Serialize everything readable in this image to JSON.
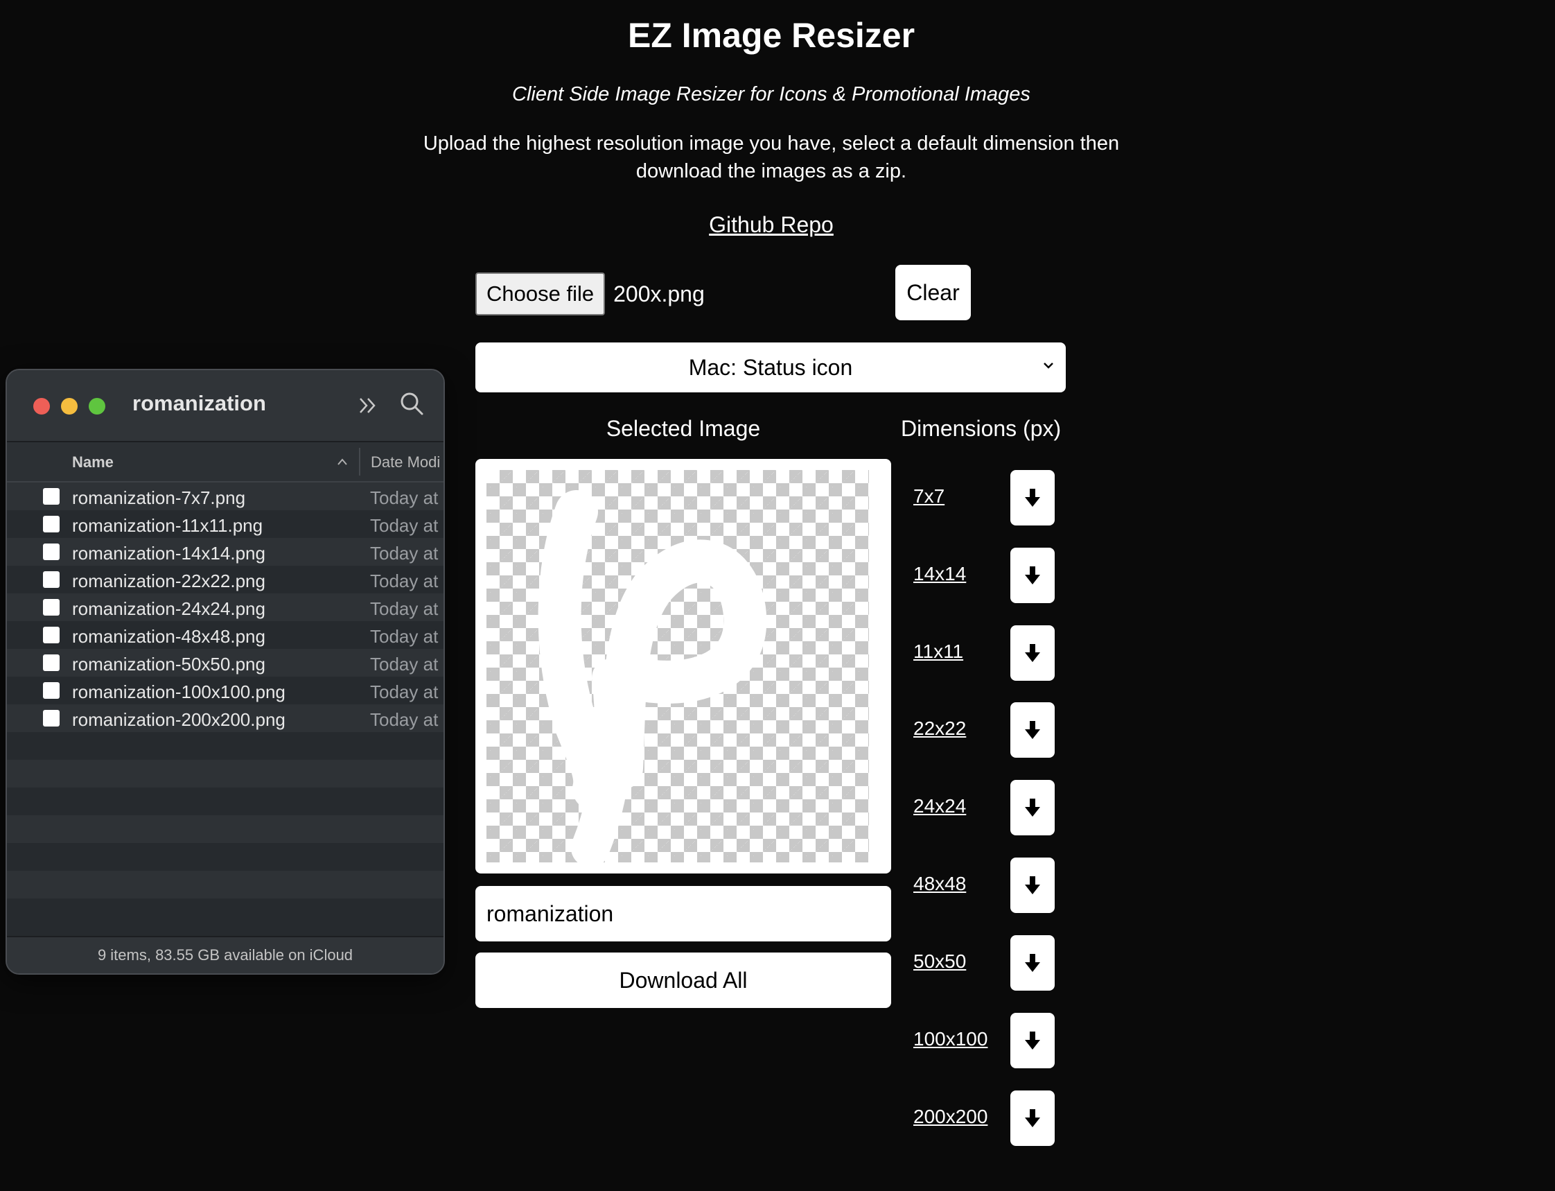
{
  "app": {
    "title": "EZ Image Resizer",
    "subtitle": "Client Side Image Resizer for Icons & Promotional Images",
    "instructions": "Upload the highest resolution image you have, select a default dimension then download the images as a zip.",
    "repo_link": "Github Repo"
  },
  "file_input": {
    "button_label": "Choose file",
    "selected_file": "200x.png"
  },
  "clear_label": "Clear",
  "preset": {
    "selected": "Mac: Status icon"
  },
  "preview": {
    "header": "Selected Image"
  },
  "dimensions": {
    "header": "Dimensions (px)",
    "items": [
      "7x7",
      "14x14",
      "11x11",
      "22x22",
      "24x24",
      "48x48",
      "50x50",
      "100x100",
      "200x200"
    ]
  },
  "name_input": {
    "value": "romanization"
  },
  "download_all_label": "Download All",
  "finder": {
    "title": "romanization",
    "columns": {
      "name": "Name",
      "date": "Date Modi"
    },
    "files": [
      {
        "name": "romanization-7x7.png",
        "date": "Today at"
      },
      {
        "name": "romanization-11x11.png",
        "date": "Today at"
      },
      {
        "name": "romanization-14x14.png",
        "date": "Today at"
      },
      {
        "name": "romanization-22x22.png",
        "date": "Today at"
      },
      {
        "name": "romanization-24x24.png",
        "date": "Today at"
      },
      {
        "name": "romanization-48x48.png",
        "date": "Today at"
      },
      {
        "name": "romanization-50x50.png",
        "date": "Today at"
      },
      {
        "name": "romanization-100x100.png",
        "date": "Today at"
      },
      {
        "name": "romanization-200x200.png",
        "date": "Today at"
      }
    ],
    "status": "9 items, 83.55 GB available on iCloud"
  }
}
